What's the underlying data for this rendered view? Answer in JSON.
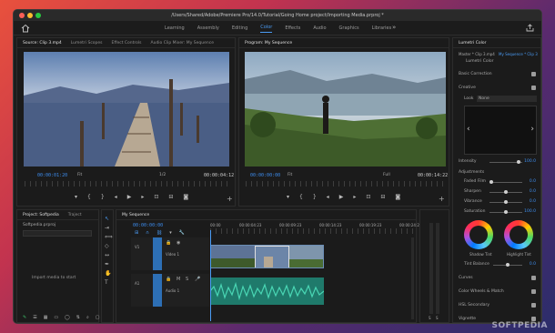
{
  "window": {
    "title": "/Users/Shared/Adobe/Premiere Pro/14.0/Tutorial/Going Home project/Importing Media.prproj *"
  },
  "nav": {
    "tabs": [
      {
        "label": "Learning"
      },
      {
        "label": "Assembly"
      },
      {
        "label": "Editing"
      },
      {
        "label": "Color"
      },
      {
        "label": "Effects"
      },
      {
        "label": "Audio"
      },
      {
        "label": "Graphics"
      },
      {
        "label": "Libraries"
      }
    ],
    "active_tab": "Color",
    "more": "»"
  },
  "source_panel": {
    "tabs": [
      "Source: Clip 3.mp4",
      "Lumetri Scopes",
      "Effect Controls",
      "Audio Clip Mixer: My Sequence"
    ],
    "timecode_in": "00:00:01:20",
    "fit": "Fit",
    "ratio": "1/2",
    "timecode_out": "00:00:04:12"
  },
  "program_panel": {
    "tabs": [
      "Program: My Sequence"
    ],
    "timecode_in": "00:00:00:00",
    "fit": "Fit",
    "ratio": "Full",
    "timecode_out": "00:00:14:22"
  },
  "lumetri": {
    "header": "Lumetri Color",
    "master": "Master * Clip 3.mp4",
    "sequence": "My Sequence * Clip 3",
    "effect": "Lumetri Color",
    "basic_correction": "Basic Correction",
    "creative": "Creative",
    "look_label": "Look",
    "look_value": "None",
    "intensity_label": "Intensity",
    "intensity_value": "100.0",
    "adjustments": "Adjustments",
    "rows": [
      {
        "label": "Faded Film",
        "value": "0.0"
      },
      {
        "label": "Sharpen",
        "value": "0.0"
      },
      {
        "label": "Vibrance",
        "value": "0.0"
      },
      {
        "label": "Saturation",
        "value": "100.0"
      }
    ],
    "shadow_tint": "Shadow Tint",
    "highlight_tint": "Highlight Tint",
    "tint_balance_label": "Tint Balance",
    "tint_balance_value": "0.0",
    "sections": [
      "Curves",
      "Color Wheels & Match",
      "HSL Secondary",
      "Vignette"
    ]
  },
  "project_panel": {
    "tabs": [
      "Project: Softpedia",
      "Traject"
    ],
    "file": "Softpedia.prproj",
    "hint": "Import media to start"
  },
  "timeline": {
    "tab": "My Sequence",
    "timecode": "00:00:00:00",
    "ruler": [
      "00:00",
      "00:00:04:23",
      "00:00:09:23",
      "00:00:14:23",
      "00:00:19:23",
      "00:00:24:23"
    ],
    "tracks": [
      {
        "id": "V1",
        "name": "Video 1"
      },
      {
        "id": "A1",
        "name": "Audio 1"
      }
    ]
  },
  "watermark": "SOFTPEDIA",
  "colors": {
    "accent": "#4b9cf5",
    "timecode": "#3d8ef0",
    "audio_clip": "#1f7a6b"
  }
}
